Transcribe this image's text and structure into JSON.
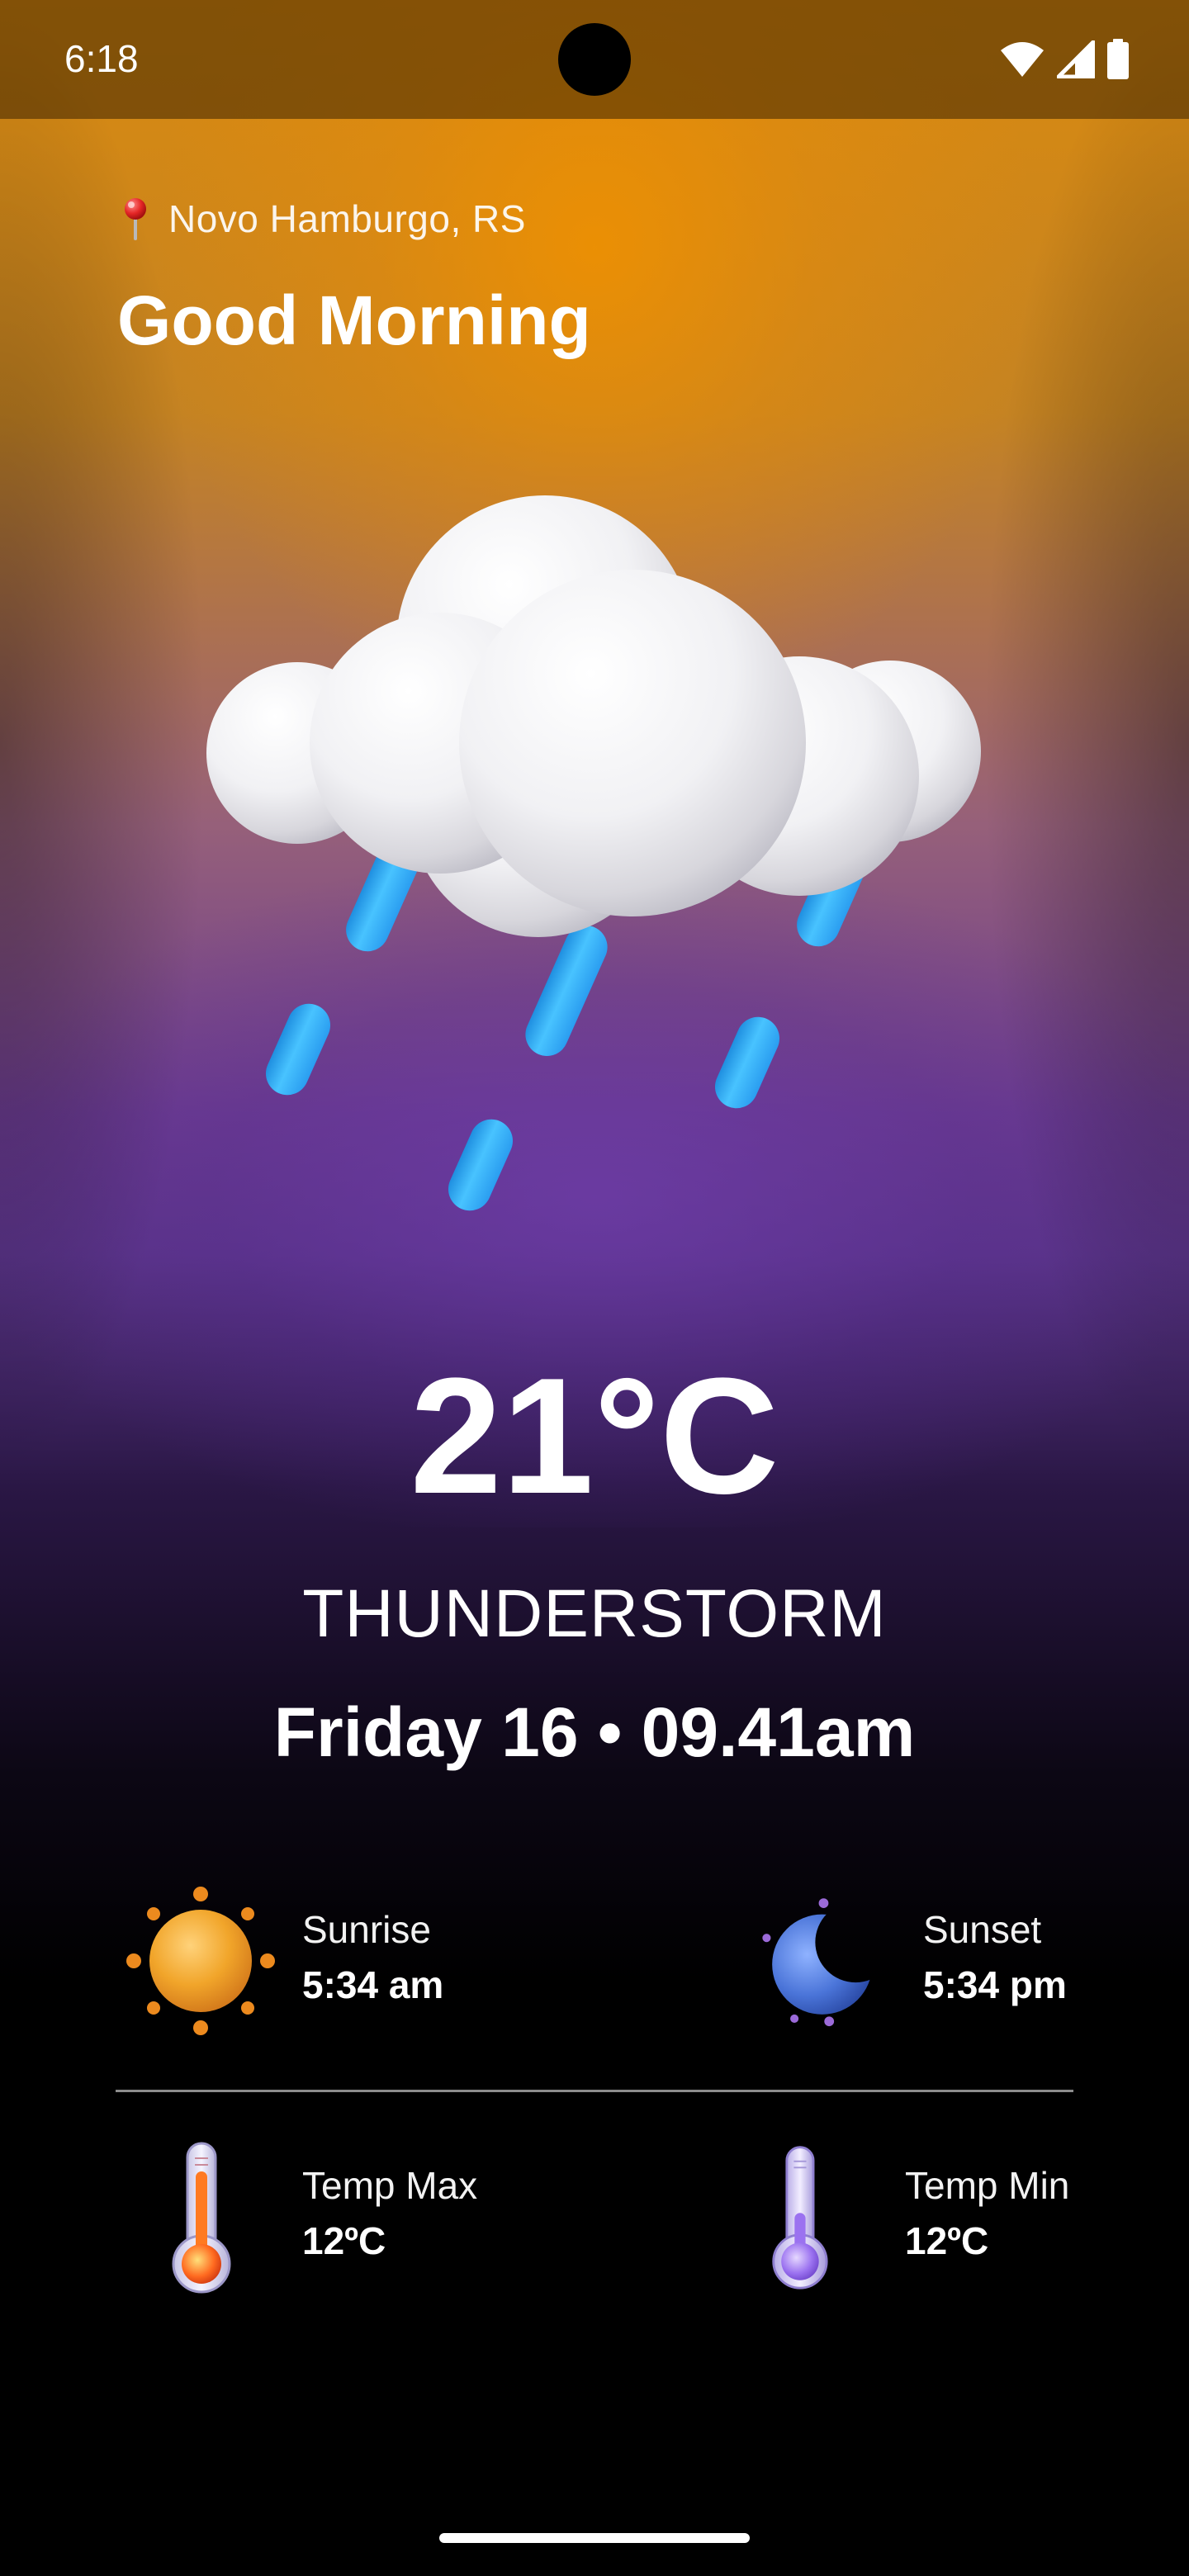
{
  "status_bar": {
    "time": "6:18"
  },
  "header": {
    "location": "Novo Hamburgo, RS",
    "greeting": "Good Morning"
  },
  "weather": {
    "temperature": "21°C",
    "condition": "THUNDERSTORM",
    "datetime": "Friday 16 • 09.41am",
    "icon": "rain-cloud-icon"
  },
  "details": {
    "sunrise": {
      "label": "Sunrise",
      "value": "5:34 am",
      "icon": "sun-icon"
    },
    "sunset": {
      "label": "Sunset",
      "value": "5:34 pm",
      "icon": "moon-icon"
    },
    "temp_max": {
      "label": "Temp Max",
      "value": "12ºC",
      "icon": "thermometer-hot-icon"
    },
    "temp_min": {
      "label": "Temp Min",
      "value": "12ºC",
      "icon": "thermometer-cold-icon"
    }
  },
  "colors": {
    "sky_top": "#d98a10",
    "sky_mid": "#6a3b8f",
    "background_bottom": "#000000",
    "rain": "#35b4f5",
    "sun": "#f1a52a",
    "moon": "#4a74d8"
  }
}
